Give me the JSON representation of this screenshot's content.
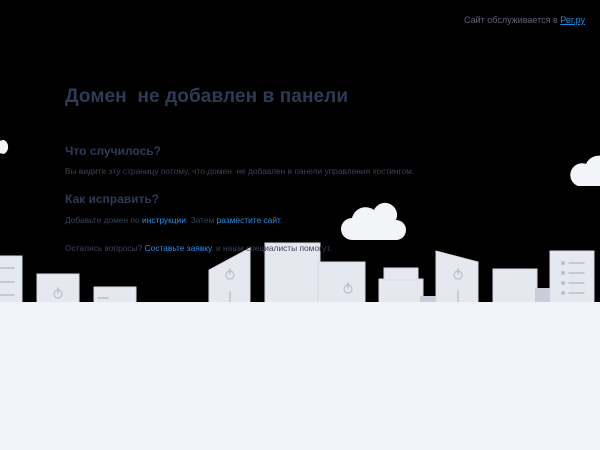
{
  "header": {
    "note_prefix": "Сайт обслуживается в ",
    "note_link": "Рег.ру"
  },
  "main": {
    "title": "Домен  не добавлен в панели",
    "what_happened": {
      "heading": "Что случилось?",
      "text": "Вы видите эту страницу потому, что домен  не добавлен в панели управления хостингом."
    },
    "how_to_fix": {
      "heading": "Как исправить?",
      "text_prefix": "Добавьте домен по ",
      "instructions_link": "инструкции",
      "text_middle": ". Затем ",
      "place_site_link": "разместите сайт",
      "text_suffix": "."
    },
    "questions": {
      "text_prefix": "Остались вопросы? ",
      "request_link": "Составьте заявку",
      "text_suffix": ", и наши специалисты помогут."
    }
  },
  "colors": {
    "background": "#000000",
    "heading": "#2f3a57",
    "link": "#1a8de6",
    "ground": "#f2f3f8",
    "building": "#e5e8ef"
  }
}
